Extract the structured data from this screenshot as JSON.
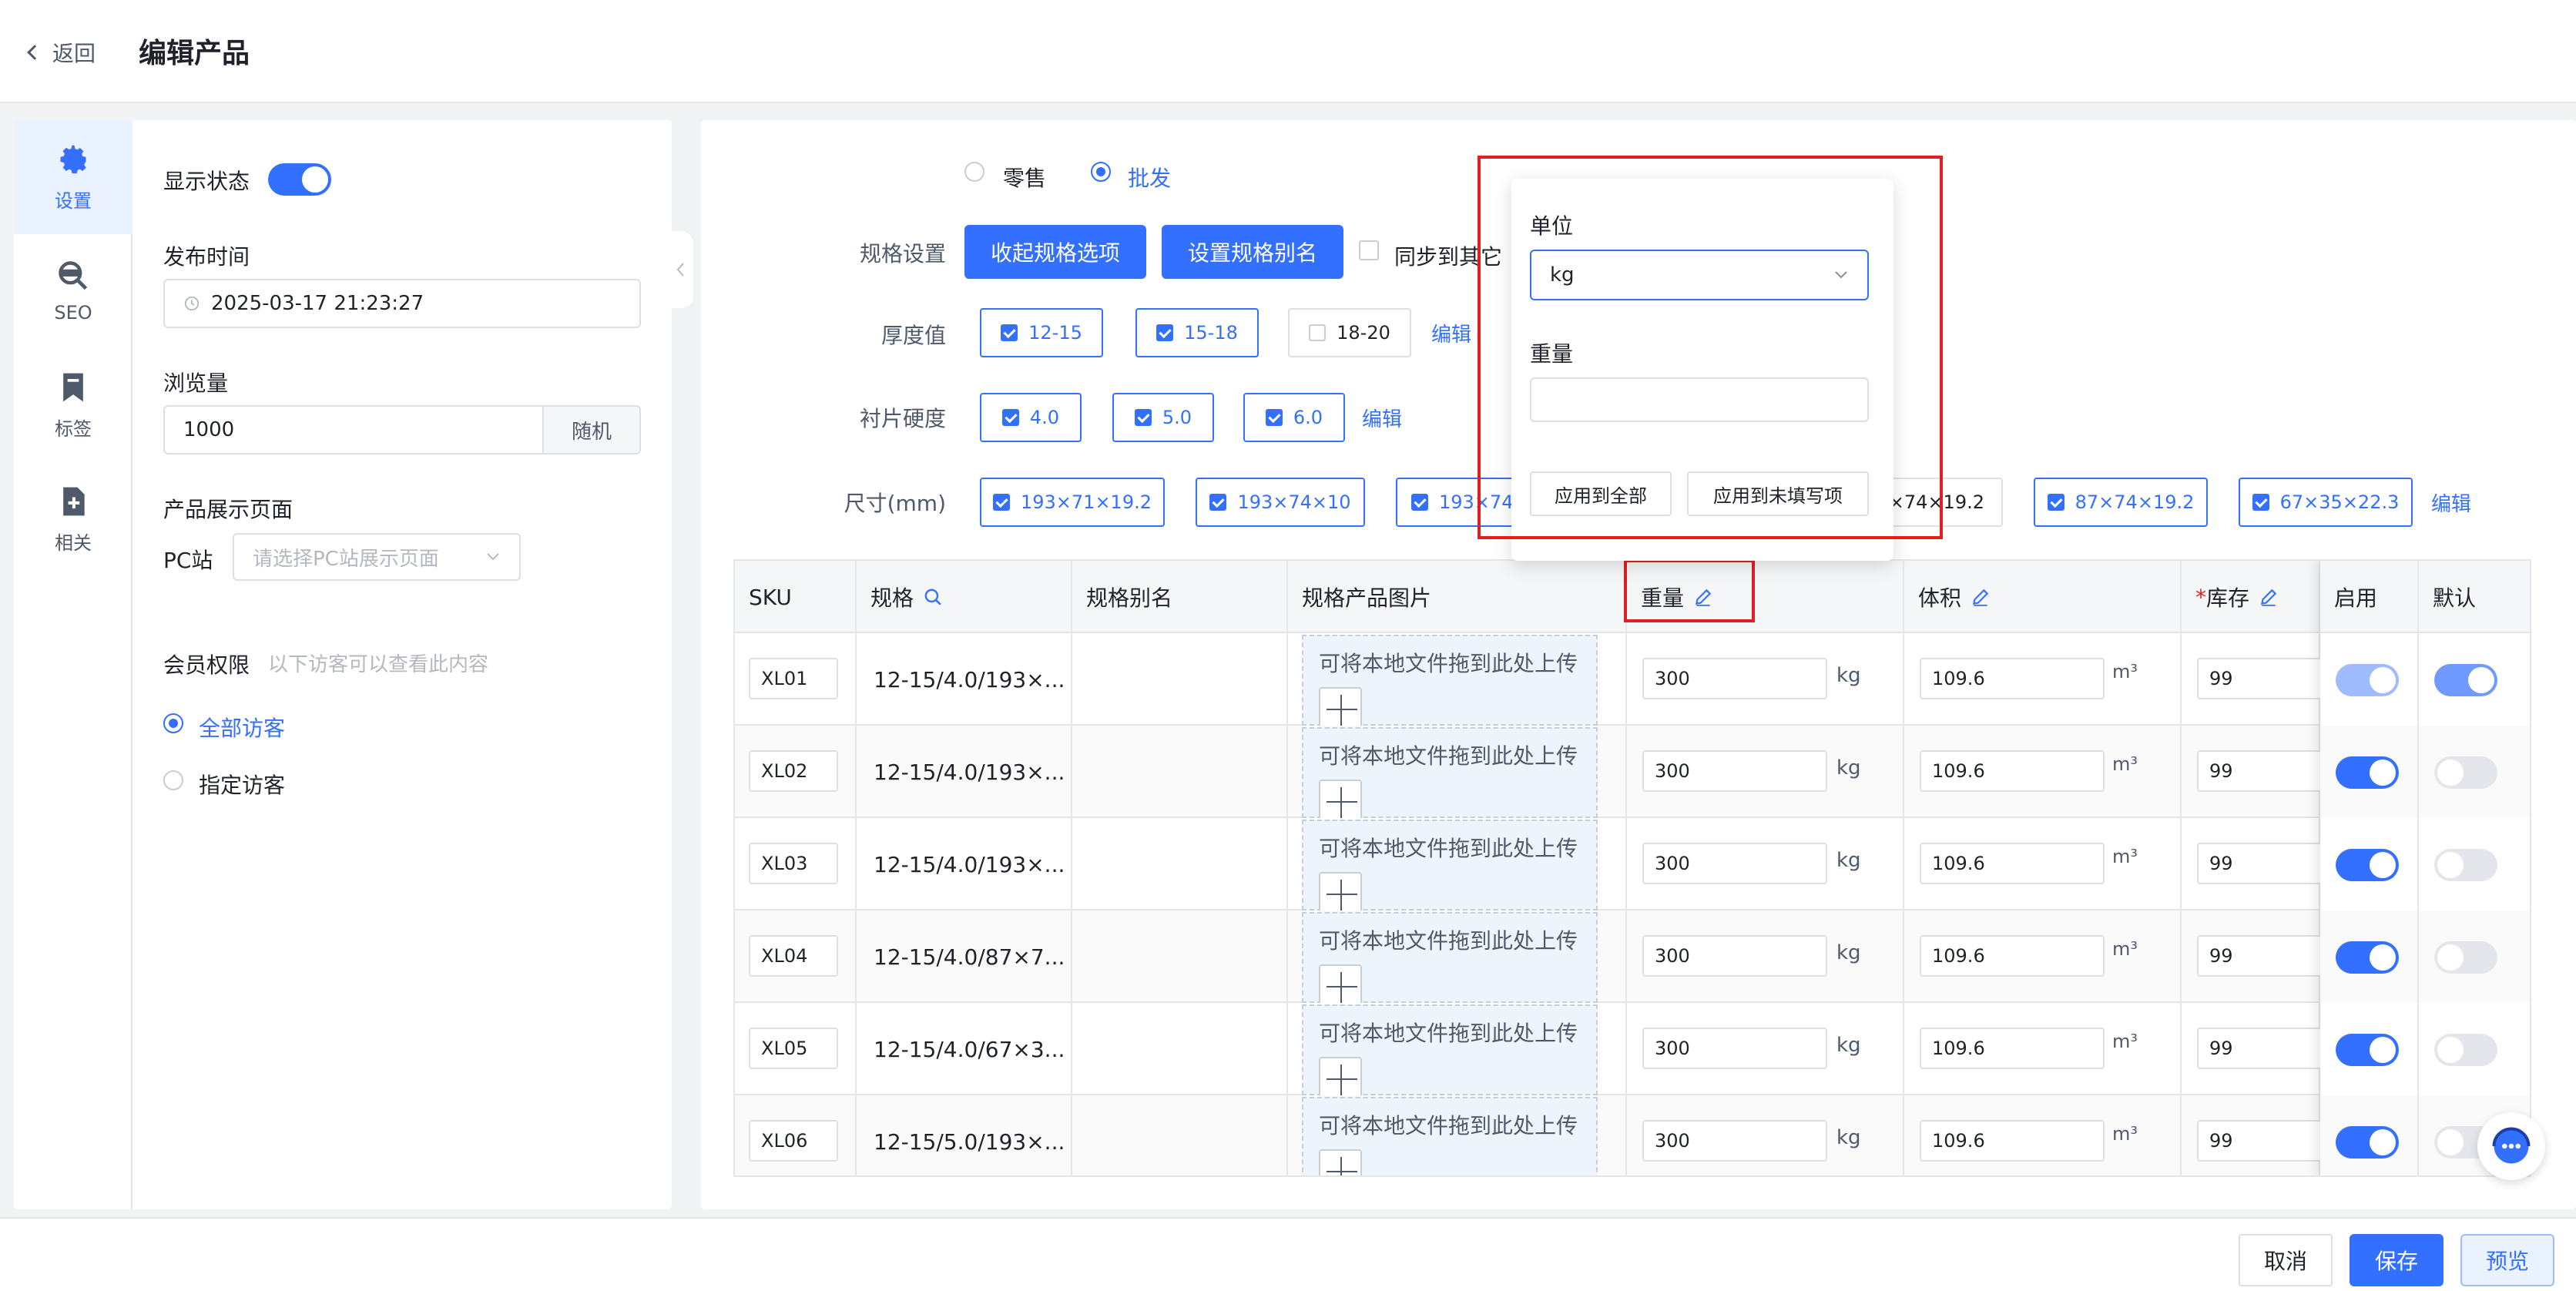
{
  "header": {
    "back_label": "返回",
    "title": "编辑产品"
  },
  "sidebar": {
    "tabs": [
      {
        "label": "设置",
        "icon": "gear-icon"
      },
      {
        "label": "SEO",
        "icon": "seo-icon"
      },
      {
        "label": "标签",
        "icon": "bookmark-icon"
      },
      {
        "label": "相关",
        "icon": "file-add-icon"
      }
    ]
  },
  "settings": {
    "display_status_label": "显示状态",
    "publish_time_label": "发布时间",
    "publish_time_value": "2025-03-17 21:23:27",
    "views_label": "浏览量",
    "views_value": "1000",
    "random_label": "随机",
    "display_page_label": "产品展示页面",
    "pc_site_label": "PC站",
    "pc_site_placeholder": "请选择PC站展示页面",
    "member_label": "会员权限",
    "member_hint": "以下访客可以查看此内容",
    "all_visitors": "全部访客",
    "specific_visitors": "指定访客"
  },
  "spec": {
    "retail_label": "零售",
    "wholesale_label": "批发",
    "spec_setting_label": "规格设置",
    "collapse_btn": "收起规格选项",
    "alias_btn": "设置规格别名",
    "sync_label": "同步到其它",
    "edit_label": "编辑",
    "thickness_label": "厚度值",
    "thickness_options": [
      "12-15",
      "15-18",
      "18-20"
    ],
    "hardness_label": "衬片硬度",
    "hardness_options": [
      "4.0",
      "5.0",
      "6.0"
    ],
    "size_label": "尺寸(mm)",
    "size_options": [
      "193×71×19.2",
      "193×74×10",
      "193×74",
      "7×74×19.2",
      "87×74×19.2",
      "67×35×22.3"
    ]
  },
  "popover": {
    "unit_label": "单位",
    "unit_value": "kg",
    "weight_label": "重量",
    "weight_value": "",
    "apply_all": "应用到全部",
    "apply_empty": "应用到未填写项"
  },
  "table": {
    "headers": {
      "sku": "SKU",
      "spec": "规格",
      "alias": "规格别名",
      "image": "规格产品图片",
      "weight": "重量",
      "volume": "体积",
      "stock_star": "*",
      "stock": "库存",
      "enable": "启用",
      "default": "默认"
    },
    "upload_text": "可将本地文件拖到此处上传",
    "weight_unit": "kg",
    "volume_unit": "m³",
    "rows": [
      {
        "sku": "XL01",
        "spec": "12-15/4.0/193×...",
        "weight": "300",
        "volume": "109.6",
        "stock": "99",
        "enabled": true,
        "default": true
      },
      {
        "sku": "XL02",
        "spec": "12-15/4.0/193×...",
        "weight": "300",
        "volume": "109.6",
        "stock": "99",
        "enabled": true,
        "default": false
      },
      {
        "sku": "XL03",
        "spec": "12-15/4.0/193×...",
        "weight": "300",
        "volume": "109.6",
        "stock": "99",
        "enabled": true,
        "default": false
      },
      {
        "sku": "XL04",
        "spec": "12-15/4.0/87×7...",
        "weight": "300",
        "volume": "109.6",
        "stock": "99",
        "enabled": true,
        "default": false
      },
      {
        "sku": "XL05",
        "spec": "12-15/4.0/67×3...",
        "weight": "300",
        "volume": "109.6",
        "stock": "99",
        "enabled": true,
        "default": false
      },
      {
        "sku": "XL06",
        "spec": "12-15/5.0/193×...",
        "weight": "300",
        "volume": "109.6",
        "stock": "99",
        "enabled": true,
        "default": false
      }
    ]
  },
  "footer": {
    "cancel": "取消",
    "save": "保存",
    "preview": "预览"
  },
  "colors": {
    "primary": "#3370ff",
    "highlight": "#e02020"
  }
}
